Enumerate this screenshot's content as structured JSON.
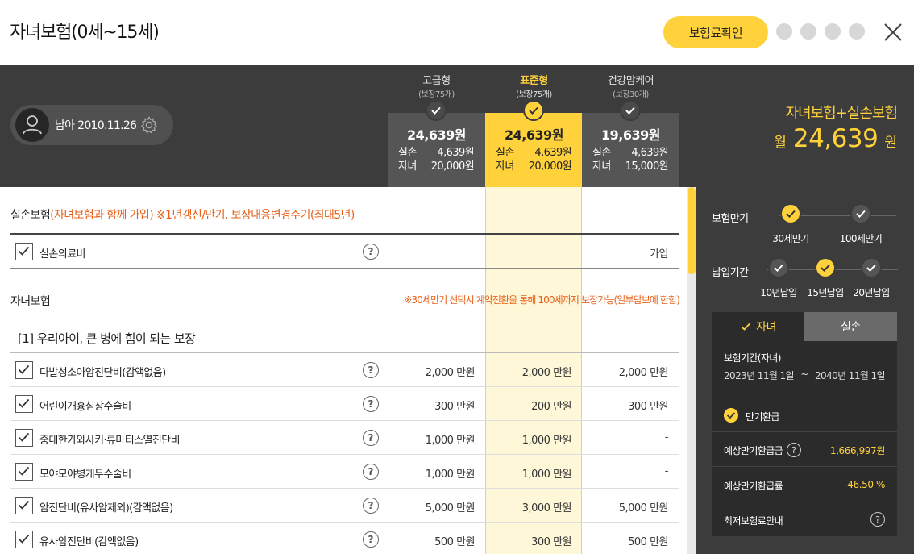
{
  "header": {
    "title": "자녀보험(0세~15세)",
    "price_button": "보험료확인"
  },
  "profile": {
    "text": "남아 2010.11.26"
  },
  "plans": [
    {
      "name": "고급형",
      "sub": "(보장75개)",
      "price": "24,639원",
      "r1_label": "실손",
      "r1_value": "4,639원",
      "r2_label": "자녀",
      "r2_value": "20,000원"
    },
    {
      "name": "표준형",
      "sub": "(보장75개)",
      "price": "24,639원",
      "r1_label": "실손",
      "r1_value": "4,639원",
      "r2_label": "자녀",
      "r2_value": "20,000원"
    },
    {
      "name": "건강맘케어",
      "sub": "(보장30개)",
      "price": "19,639원",
      "r1_label": "실손",
      "r1_value": "4,639원",
      "r2_label": "자녀",
      "r2_value": "15,000원"
    }
  ],
  "summary": {
    "title": "자녀보험+실손보험",
    "prefix": "월",
    "amount": "24,639",
    "unit": "원"
  },
  "main": {
    "section1_title": "실손보험",
    "section1_note": "(자녀보험과 함께 가입) ※1년갱신/만기, 보장내용변경주기(최대5년)",
    "row_silson": {
      "label": "실손의료비",
      "value": "가입"
    },
    "section2_title": "자녀보험",
    "section2_note": "※30세만기 선택시 계약전환을 통해 100세까지 보장가능(일부담보에 한함)",
    "group1_title": "[1] 우리아이, 큰 병에 힘이 되는 보장",
    "rows": [
      {
        "label": "다발성소아암진단비(감액없음)",
        "v1": "2,000 만원",
        "v2": "2,000 만원",
        "v3": "2,000 만원"
      },
      {
        "label": "어린이개흉심장수술비",
        "v1": "300 만원",
        "v2": "200 만원",
        "v3": "300 만원"
      },
      {
        "label": "중대한가와사키·류마티스열진단비",
        "v1": "1,000 만원",
        "v2": "1,000 만원",
        "v3": "-"
      },
      {
        "label": "모야모야병개두수술비",
        "v1": "1,000 만원",
        "v2": "1,000 만원",
        "v3": "-"
      },
      {
        "label": "암진단비(유사암제외)(감액없음)",
        "v1": "5,000 만원",
        "v2": "3,000 만원",
        "v3": "5,000 만원"
      },
      {
        "label": "유사암진단비(감액없음)",
        "v1": "500 만원",
        "v2": "300 만원",
        "v3": "500 만원"
      }
    ],
    "qmark": "?"
  },
  "panel": {
    "maturity_label": "보험만기",
    "maturity_options": [
      "30세만기",
      "100세만기"
    ],
    "payment_label": "납입기간",
    "payment_options": [
      "10년납입",
      "15년납입",
      "20년납입"
    ],
    "tabs": [
      "자녀",
      "실손"
    ],
    "period_label": "보험기간(자녀)",
    "period_start": "2023년 11월 1일",
    "period_sep": "~",
    "period_end": "2040년 11월 1일",
    "refund_label": "만기환급",
    "expected_refund_label": "예상만기환급금",
    "expected_refund_value": "1,666,997원",
    "expected_rate_label": "예상만기환급률",
    "expected_rate_value": "46.50 %",
    "min_premium_label": "최저보험료안내"
  },
  "colors": {
    "accent": "#ffd23c",
    "dark": "#3c3c3c",
    "orange": "#e8601a"
  }
}
